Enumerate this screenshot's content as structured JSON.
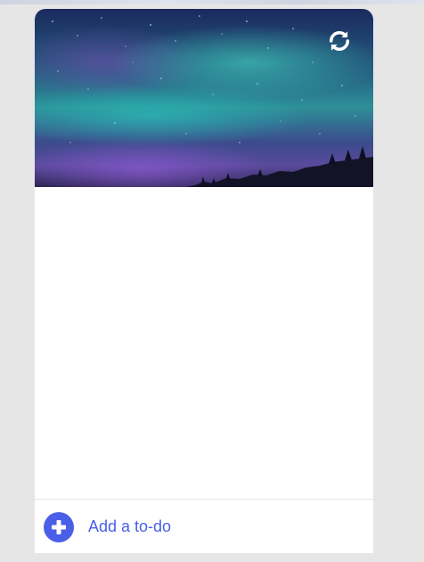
{
  "header": {
    "image_icon": "aurora-night-sky-image",
    "refresh_icon": "refresh-icon"
  },
  "footer": {
    "add_icon": "plus-circle-icon",
    "add_label": "Add a to-do"
  },
  "colors": {
    "accent": "#4a5ee8",
    "background": "#e6e6e6",
    "card": "#ffffff"
  },
  "todos": []
}
